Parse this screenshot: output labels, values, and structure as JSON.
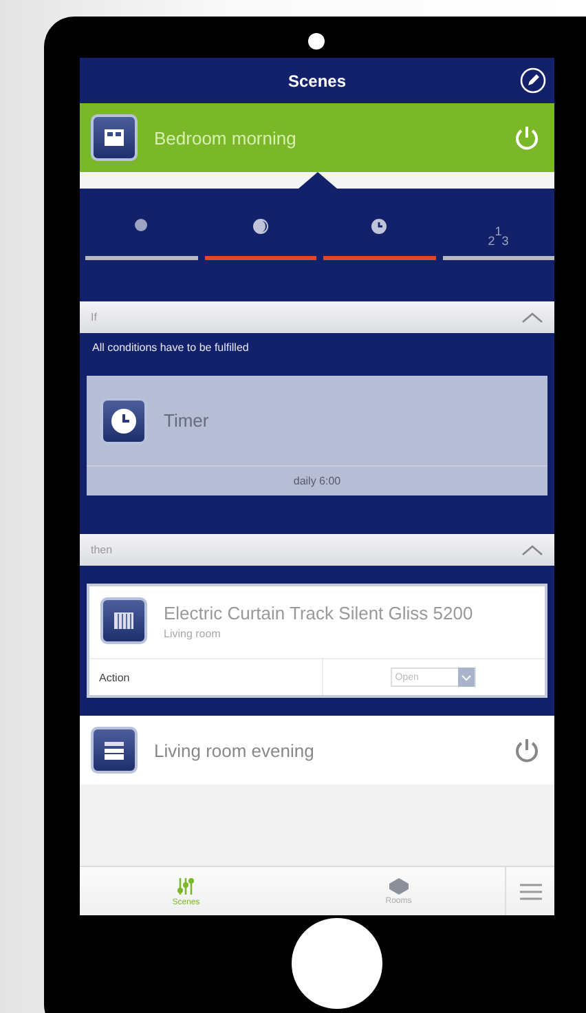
{
  "header": {
    "title": "Scenes"
  },
  "scenes": [
    {
      "name": "Bedroom morning",
      "active": true
    },
    {
      "name": "Living room evening",
      "active": false
    }
  ],
  "tabs": [
    {
      "kind": "dot",
      "active": false
    },
    {
      "kind": "moon",
      "active": true
    },
    {
      "kind": "clock",
      "active": true
    },
    {
      "kind": "order",
      "glyph": "$_{2}$$^{1}$$_{3}$",
      "active": false
    }
  ],
  "conditions": {
    "label": "If",
    "expanded": true,
    "note": "All conditions have to be fulfilled",
    "card": {
      "title": "Timer",
      "detail": "daily 6:00"
    }
  },
  "actions": {
    "label": "then",
    "expanded": true,
    "card": {
      "title": "Electric Curtain Track Silent Gliss 5200",
      "room": "Living room",
      "field_label": "Action",
      "value": "Open"
    }
  },
  "bottom_nav": [
    {
      "label": "Scenes",
      "selected": true
    },
    {
      "label": "Rooms",
      "selected": false
    }
  ]
}
